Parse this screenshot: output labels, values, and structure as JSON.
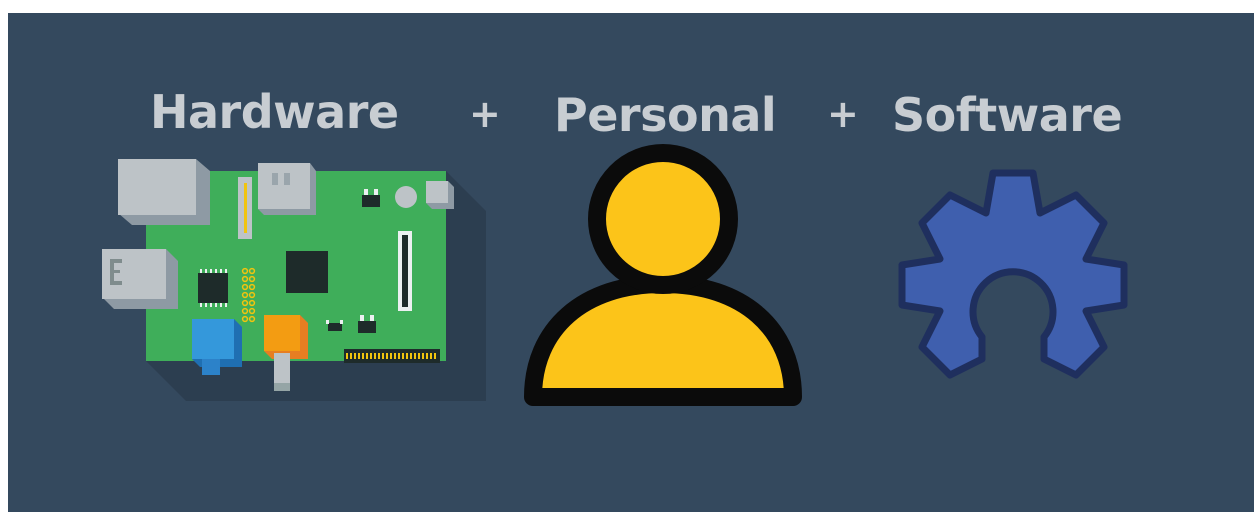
{
  "banner": {
    "words": {
      "hardware": "Hardware",
      "personal": "Personal",
      "software": "Software"
    },
    "operators": {
      "first": "+",
      "second": "+"
    }
  },
  "illustrations": {
    "hardware": "circuit-board-icon",
    "personal": "user-icon",
    "software": "open-source-gear-icon"
  },
  "colors": {
    "background": "#34495e",
    "text": "#c8cdd2",
    "board_green": "#3fae5a",
    "person_yellow": "#fcc419",
    "gear_blue": "#3f5fae"
  }
}
